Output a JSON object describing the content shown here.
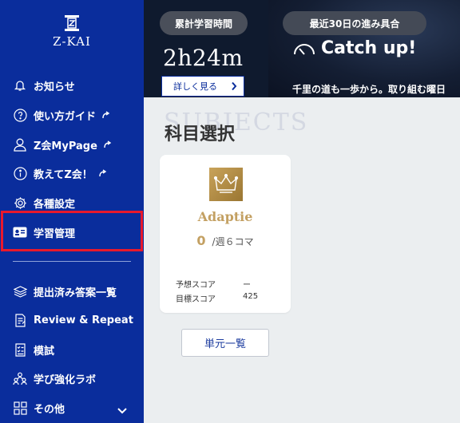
{
  "brand": {
    "name": "Z-KAI"
  },
  "sidebar": {
    "items": [
      {
        "label": "お知らせ",
        "icon": "bell-icon",
        "external": false
      },
      {
        "label": "使い方ガイド",
        "icon": "question-icon",
        "external": true
      },
      {
        "label": "Z会MyPage",
        "icon": "user-icon",
        "external": true
      },
      {
        "label": "教えてZ会！",
        "icon": "info-icon",
        "external": true
      },
      {
        "label": "各種設定",
        "icon": "gear-icon",
        "external": false
      },
      {
        "label": "学習管理",
        "icon": "id-card-icon",
        "external": false,
        "highlighted": true
      },
      {
        "label": "提出済み答案一覧",
        "icon": "layers-icon",
        "external": false
      },
      {
        "label": "Review & Repeat",
        "icon": "document-edit-icon",
        "external": false
      },
      {
        "label": "模試",
        "icon": "checklist-icon",
        "external": false
      },
      {
        "label": "学び強化ラボ",
        "icon": "people-icon",
        "external": false
      },
      {
        "label": "その他",
        "icon": "grid-icon",
        "external": false,
        "expandable": true
      }
    ]
  },
  "banner": {
    "total_label": "累計学習時間",
    "total_value": "2h24m",
    "details_label": "詳しく見る",
    "progress_label": "最近30日の進み具合",
    "progress_status": "Catch up!",
    "motto": "千里の道も一歩から。取り組む曜日"
  },
  "content": {
    "bg_title": "SUBJECTS",
    "title": "科目選択",
    "card": {
      "title": "Adaptie",
      "week_count": "0",
      "week_suffix": "/週６コマ",
      "predicted_label": "予想スコア",
      "predicted_value": "ー",
      "target_label": "目標スコア",
      "target_value": "425"
    },
    "unit_list_label": "単元一覧"
  },
  "colors": {
    "sidebar": "#0a2d9c",
    "highlight": "#e8192c",
    "gold": "#c3a062",
    "banner": "#0f1a2e"
  }
}
